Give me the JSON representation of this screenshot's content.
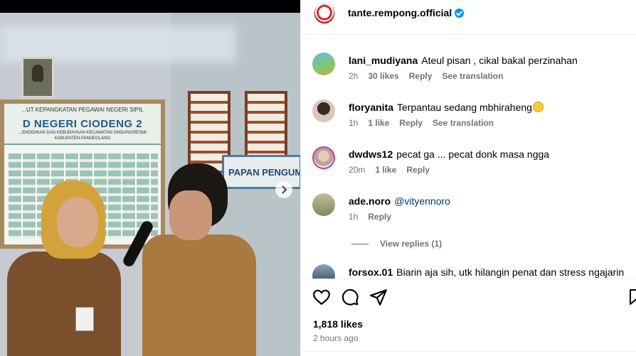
{
  "post": {
    "username": "tante.rempong.official",
    "likes": "1,818 likes",
    "time": "2 hours ago"
  },
  "media": {
    "board_line1": "...UT KEPANGKATAN PEGAWAI NEGERI SIPIL",
    "board_title": "D NEGERI CIODENG 2",
    "board_line2": "...ENDIDIKAN DAN KEBUDAYAAN KECAMATAN SINDANGRESMI",
    "board_line3": "KABUPATEN PANDEGLANG",
    "sign_text": "PAPAN PENGUMUMA"
  },
  "comments": [
    {
      "user": "lani_mudiyana",
      "text": "Ateul pisan , cikal bakal perzinahan",
      "age": "2h",
      "likes": "30 likes",
      "reply": "Reply",
      "translate": "See translation"
    },
    {
      "user": "floryanita",
      "text": "Terpantau sedang mbhiraheng",
      "age": "1h",
      "likes": "1 like",
      "reply": "Reply",
      "translate": "See translation"
    },
    {
      "user": "dwdws12",
      "text": "pecat ga ... pecat donk masa ngga",
      "age": "20m",
      "likes": "1 like",
      "reply": "Reply"
    },
    {
      "user": "ade.noro",
      "mention": "@vityennoro",
      "age": "1h",
      "reply": "Reply"
    },
    {
      "user": "forsox.01",
      "text": "Biarin aja sih, utk hilangin penat dan stress ngajarin"
    }
  ],
  "view_replies": "View replies (1)",
  "icons": [
    "heart-icon",
    "comment-icon",
    "share-icon",
    "bookmark-icon",
    "chevron-right-icon",
    "verified-icon"
  ],
  "colors": {
    "verified": "#0095f6",
    "mention": "#00376b",
    "muted": "#737373"
  }
}
